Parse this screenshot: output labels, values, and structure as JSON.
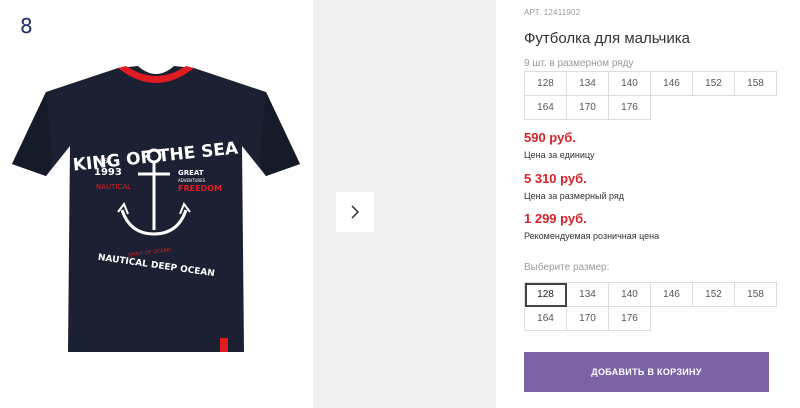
{
  "gallery": {
    "counter": "8",
    "shirt_print": {
      "headline": "KING OF THE SEA",
      "est": "EST",
      "year": "1993",
      "great": "GREAT",
      "adventures": "ADVENTURES",
      "nautical": "NAUTICAL",
      "freedom": "FREEDOM",
      "spirit": "SPIRIT OF OCEAN",
      "bottom": "NAUTICAL DEEP OCEAN"
    },
    "next_icon": "chevron-right-icon"
  },
  "product": {
    "sku": "АРТ. 12411902",
    "title": "Футболка для мальчика",
    "pack_note": "9 шт. в размерном ряду",
    "pack_sizes": [
      "128",
      "134",
      "140",
      "146",
      "152",
      "158",
      "164",
      "170",
      "176"
    ],
    "unit_price": "590 руб.",
    "unit_price_label": "Цена за единицу",
    "row_price": "5 310 руб.",
    "row_price_label": "Цена за размерный ряд",
    "retail_price": "1 299 руб.",
    "retail_price_label": "Рекомендуемая розничная цена",
    "choose_label": "Выберите размер:",
    "selectable_sizes": [
      "128",
      "134",
      "140",
      "146",
      "152",
      "158",
      "164",
      "170",
      "176"
    ],
    "selected_size": "128",
    "add_to_cart": "ДОБАВИТЬ В КОРЗИНУ",
    "colors": {
      "price": "#d8232a",
      "button": "#7b63a6"
    }
  }
}
